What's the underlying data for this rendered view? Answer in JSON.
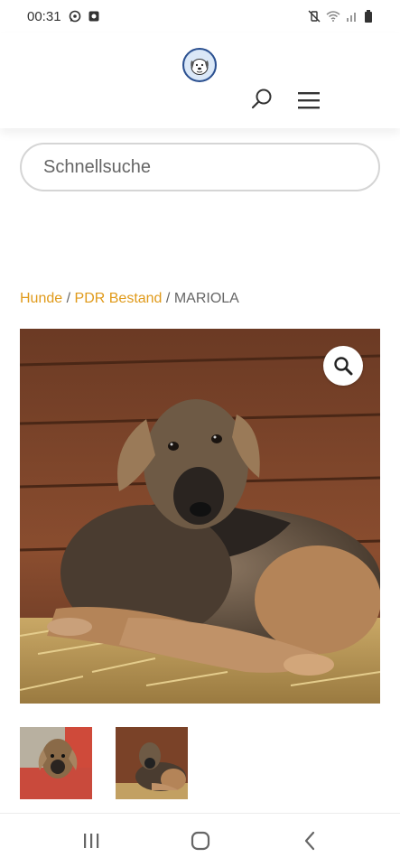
{
  "status_bar": {
    "time": "00:31",
    "left_icons": [
      "whatsapp-icon",
      "notification-icon"
    ],
    "right_icons": [
      "mute-vibrate-icon",
      "wifi-icon",
      "signal-icon",
      "battery-icon"
    ]
  },
  "header": {
    "logo_icon": "dog-logo-icon",
    "search_icon": "search-icon",
    "menu_icon": "hamburger-menu-icon"
  },
  "quick_search": {
    "placeholder": "Schnellsuche"
  },
  "breadcrumb": {
    "items": [
      {
        "label": "Hunde",
        "link": true
      },
      {
        "label": "PDR Bestand",
        "link": true
      },
      {
        "label": "MARIOLA",
        "link": false
      }
    ],
    "separator": "/"
  },
  "gallery": {
    "zoom_icon": "magnifier-zoom-icon",
    "thumbnails": [
      "thumbnail-1",
      "thumbnail-2"
    ]
  },
  "nav_bar": {
    "buttons": [
      "recent-apps-icon",
      "home-icon",
      "back-icon"
    ]
  },
  "colors": {
    "link": "#e09a1a",
    "text": "#666666",
    "border": "#d5d5d5"
  }
}
